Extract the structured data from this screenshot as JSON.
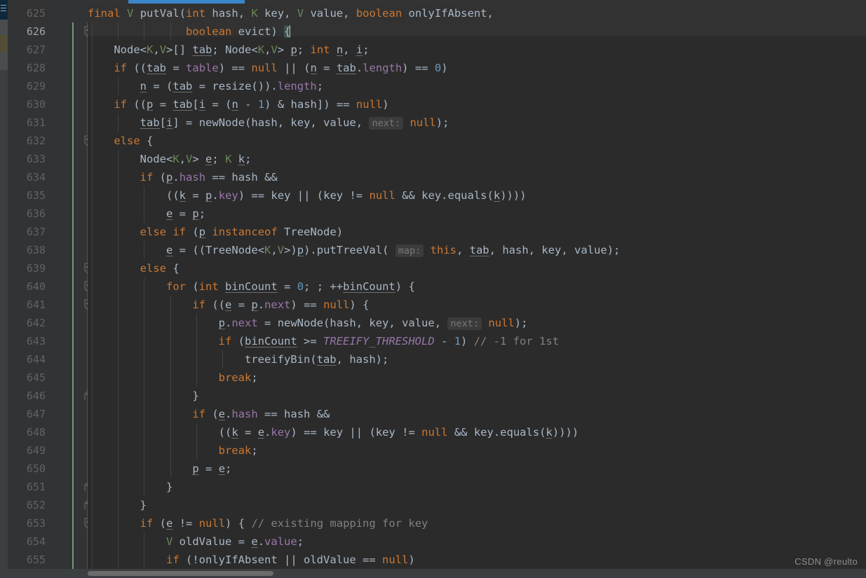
{
  "editor": {
    "theme_name": "Darcula",
    "language": "Java",
    "colors": {
      "background": "#2B2B2B",
      "gutter_background": "#313335",
      "caret_line": "#323232",
      "keyword": "#CC7832",
      "default_text": "#A9B7C6",
      "field": "#9876AA",
      "number": "#6897BB",
      "comment": "#808080",
      "generic_type": "#6A8759",
      "constant_italic": "#9876AA",
      "inlay_hint": "#787878",
      "change_marker": "#6E9C7B",
      "accent_blue": "#3C87C9",
      "brace_match": "#3B514D"
    },
    "first_line_number": 625,
    "current_line_number": 626,
    "caret_column_marker": "{"
  },
  "toolstrip": {
    "selected_item_name": "project-tool-window",
    "icon": "hamburger-icon"
  },
  "gutter": {
    "line_numbers": [
      625,
      626,
      627,
      628,
      629,
      630,
      631,
      632,
      633,
      634,
      635,
      636,
      637,
      638,
      639,
      640,
      641,
      642,
      643,
      644,
      645,
      646,
      647,
      648,
      649,
      650,
      651,
      652,
      653,
      654,
      655
    ],
    "fold_markers": [
      {
        "line": 626,
        "type": "collapse-minus"
      },
      {
        "line": 632,
        "type": "collapse-minus"
      },
      {
        "line": 639,
        "type": "collapse-minus"
      },
      {
        "line": 640,
        "type": "collapse-minus"
      },
      {
        "line": 641,
        "type": "collapse-minus"
      },
      {
        "line": 646,
        "type": "collapse-end"
      },
      {
        "line": 651,
        "type": "collapse-end"
      },
      {
        "line": 652,
        "type": "collapse-end"
      },
      {
        "line": 653,
        "type": "collapse-minus"
      }
    ]
  },
  "code": {
    "lines": [
      {
        "n": 625,
        "text": "        final V putVal(int hash, K key, V value, boolean onlyIfAbsent,"
      },
      {
        "n": 626,
        "text": "                       boolean evict) {"
      },
      {
        "n": 627,
        "text": "            Node<K,V>[] tab; Node<K,V> p; int n, i;"
      },
      {
        "n": 628,
        "text": "            if ((tab = table) == null || (n = tab.length) == 0)"
      },
      {
        "n": 629,
        "text": "                n = (tab = resize()).length;"
      },
      {
        "n": 630,
        "text": "            if ((p = tab[i = (n - 1) & hash]) == null)"
      },
      {
        "n": 631,
        "text": "                tab[i] = newNode(hash, key, value, next: null);"
      },
      {
        "n": 632,
        "text": "            else {"
      },
      {
        "n": 633,
        "text": "                Node<K,V> e; K k;"
      },
      {
        "n": 634,
        "text": "                if (p.hash == hash &&"
      },
      {
        "n": 635,
        "text": "                    ((k = p.key) == key || (key != null && key.equals(k))))"
      },
      {
        "n": 636,
        "text": "                    e = p;"
      },
      {
        "n": 637,
        "text": "                else if (p instanceof TreeNode)"
      },
      {
        "n": 638,
        "text": "                    e = ((TreeNode<K,V>)p).putTreeVal( map: this, tab, hash, key, value);"
      },
      {
        "n": 639,
        "text": "                else {"
      },
      {
        "n": 640,
        "text": "                    for (int binCount = 0; ; ++binCount) {"
      },
      {
        "n": 641,
        "text": "                        if ((e = p.next) == null) {"
      },
      {
        "n": 642,
        "text": "                            p.next = newNode(hash, key, value, next: null);"
      },
      {
        "n": 643,
        "text": "                            if (binCount >= TREEIFY_THRESHOLD - 1) // -1 for 1st"
      },
      {
        "n": 644,
        "text": "                                treeifyBin(tab, hash);"
      },
      {
        "n": 645,
        "text": "                            break;"
      },
      {
        "n": 646,
        "text": "                        }"
      },
      {
        "n": 647,
        "text": "                        if (e.hash == hash &&"
      },
      {
        "n": 648,
        "text": "                            ((k = e.key) == key || (key != null && key.equals(k))))"
      },
      {
        "n": 649,
        "text": "                            break;"
      },
      {
        "n": 650,
        "text": "                        p = e;"
      },
      {
        "n": 651,
        "text": "                    }"
      },
      {
        "n": 652,
        "text": "                }"
      },
      {
        "n": 653,
        "text": "                if (e != null) { // existing mapping for key"
      },
      {
        "n": 654,
        "text": "                    V oldValue = e.value;"
      },
      {
        "n": 655,
        "text": "                    if (!onlyIfAbsent || oldValue == null)"
      }
    ],
    "inlay_hints": [
      {
        "line": 631,
        "label": "next:"
      },
      {
        "line": 638,
        "label": "map:"
      },
      {
        "line": 642,
        "label": "next:"
      }
    ],
    "comments": [
      {
        "line": 643,
        "text": "// -1 for 1st"
      },
      {
        "line": 653,
        "text": "// existing mapping for key"
      }
    ]
  },
  "watermark": {
    "text": "CSDN @reulto"
  }
}
